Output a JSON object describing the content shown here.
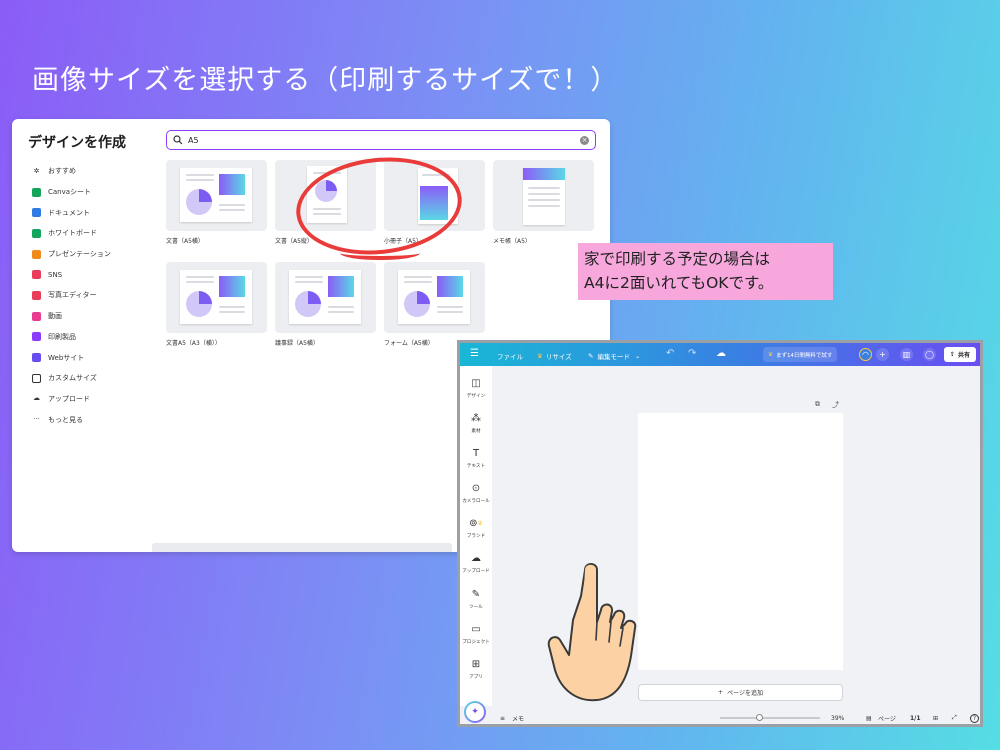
{
  "slide": {
    "title": "画像サイズを選択する（印刷するサイズで！）",
    "note_line1": "家で印刷する予定の場合は",
    "note_line2": "A4に2面いれてもOKです。"
  },
  "create_panel": {
    "heading": "デザインを作成",
    "search_value": "A5",
    "menu": [
      {
        "label": "おすすめ",
        "icon": "sparkle-icon",
        "color": "#333333"
      },
      {
        "label": "Canvaシート",
        "icon": "sheet-icon",
        "color": "#13a55b"
      },
      {
        "label": "ドキュメント",
        "icon": "doc-icon",
        "color": "#2d7be3"
      },
      {
        "label": "ホワイトボード",
        "icon": "whiteboard-icon",
        "color": "#13a55b"
      },
      {
        "label": "プレゼンテーション",
        "icon": "presentation-icon",
        "color": "#f08b1a"
      },
      {
        "label": "SNS",
        "icon": "sns-icon",
        "color": "#ea3b5a"
      },
      {
        "label": "写真エディター",
        "icon": "camera-icon",
        "color": "#ea3b5a"
      },
      {
        "label": "動画",
        "icon": "video-icon",
        "color": "#e83a8e"
      },
      {
        "label": "印刷製品",
        "icon": "printer-icon",
        "color": "#8b3dff"
      },
      {
        "label": "Webサイト",
        "icon": "web-icon",
        "color": "#6a4df2"
      },
      {
        "label": "カスタムサイズ",
        "icon": "crop-icon",
        "color": "#333333"
      },
      {
        "label": "アップロード",
        "icon": "upload-icon",
        "color": "#333333"
      },
      {
        "label": "もっと見る",
        "icon": "more-icon",
        "color": "#333333"
      }
    ],
    "templates": [
      {
        "label": "文書（A5横）"
      },
      {
        "label": "文書（A5縦）"
      },
      {
        "label": "小冊子（A5）"
      },
      {
        "label": "メモ帳（A5）"
      },
      {
        "label": "文書A5（A3（横））"
      },
      {
        "label": "議事録（A5横）"
      },
      {
        "label": "フォーム（A5横）"
      }
    ]
  },
  "editor": {
    "topbar": {
      "file": "ファイル",
      "resize": "リサイズ",
      "edit_mode": "編集モード",
      "trial": "まず14日間無料で試す",
      "share": "共有"
    },
    "rail": [
      {
        "label": "デザイン",
        "icon": "design-icon"
      },
      {
        "label": "素材",
        "icon": "elements-icon"
      },
      {
        "label": "テキスト",
        "icon": "text-icon"
      },
      {
        "label": "カメラロール",
        "icon": "camera-roll-icon"
      },
      {
        "label": "ブランド",
        "icon": "brand-icon"
      },
      {
        "label": "アップロード",
        "icon": "upload-icon"
      },
      {
        "label": "ツール",
        "icon": "draw-icon"
      },
      {
        "label": "プロジェクト",
        "icon": "folder-icon"
      },
      {
        "label": "アプリ",
        "icon": "apps-icon"
      }
    ],
    "add_page": "ページを追加",
    "memo": "メモ",
    "zoom": "39%",
    "zoom_fraction": 0.39,
    "pages_label": "ページ",
    "page_count": "1/1"
  }
}
